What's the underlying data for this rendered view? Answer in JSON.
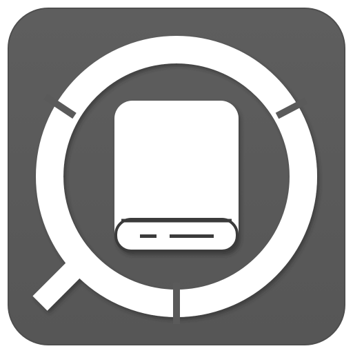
{
  "icon": {
    "name": "storage-analyzer-app-icon",
    "glyphs": [
      "magnifier-ring-icon",
      "external-drive-icon"
    ],
    "colors": {
      "tile": "#5b5b5b",
      "tile_edge": "#4e4e4e",
      "glyph": "#ffffff",
      "shadow": "#2c2c2c",
      "background": "#ffffff"
    }
  }
}
